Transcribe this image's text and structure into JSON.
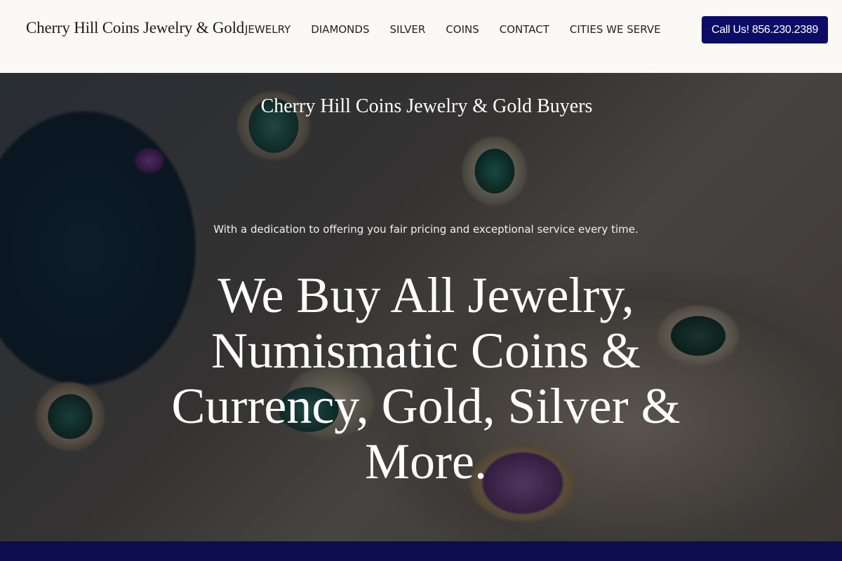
{
  "header": {
    "logo": "Cherry Hill Coins Jewelry & Gold",
    "nav": [
      {
        "label": "JEWELRY"
      },
      {
        "label": "DIAMONDS"
      },
      {
        "label": "SILVER"
      },
      {
        "label": "COINS"
      },
      {
        "label": "CONTACT"
      },
      {
        "label": "CITIES WE SERVE"
      }
    ],
    "call_button": "Call Us! 856.230.2389"
  },
  "hero": {
    "subtitle": "Cherry Hill Coins Jewelry & Gold Buyers",
    "tagline": "With a dedication to offering you fair pricing and exceptional service every time.",
    "heading": "We Buy All Jewelry, Numismatic Coins & Currency, Gold, Silver & More."
  },
  "colors": {
    "accent": "#0c0c66",
    "header_bg": "#faf9f5",
    "bottom_band": "#0c0c4e"
  }
}
